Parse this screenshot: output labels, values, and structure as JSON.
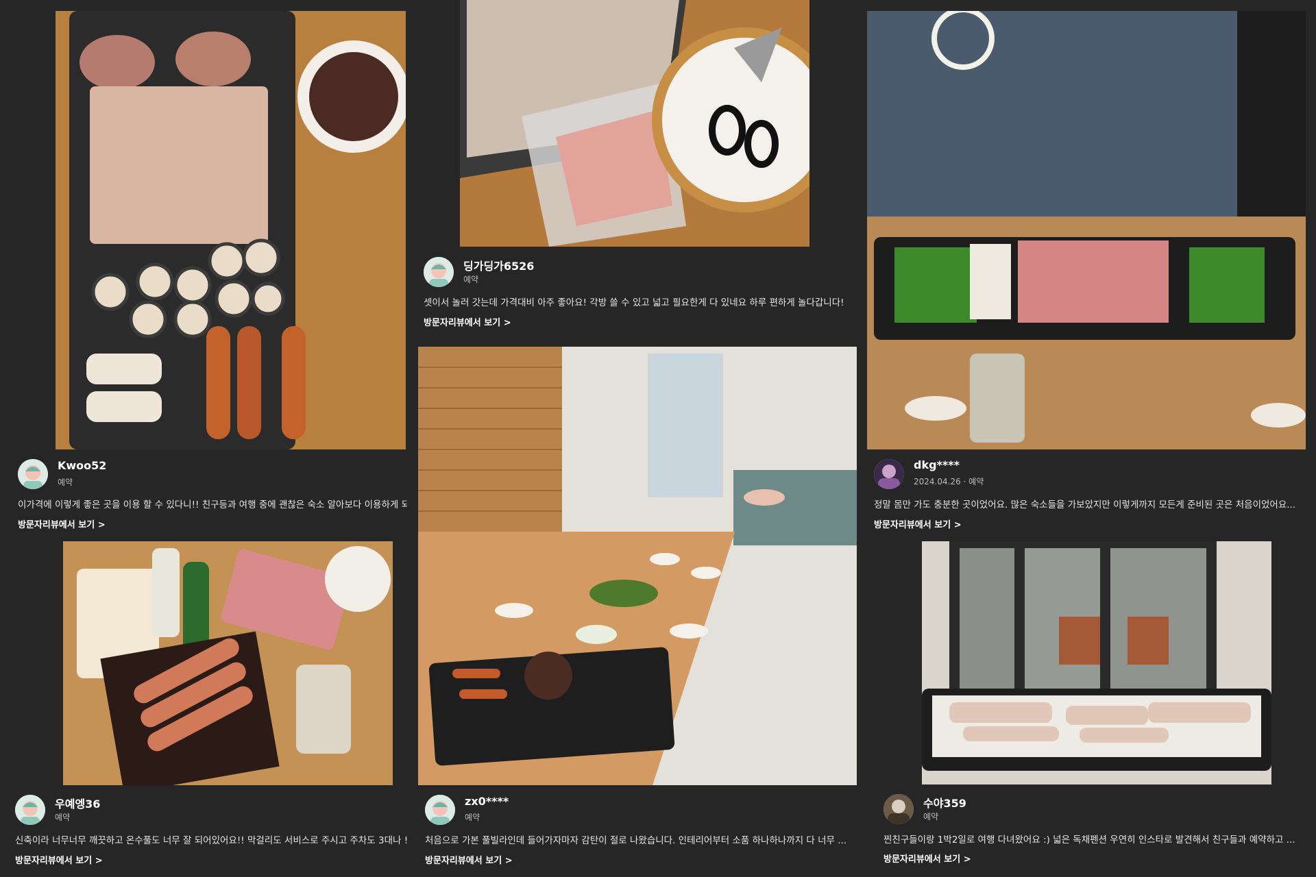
{
  "reviews": [
    {
      "user": "Kwoo52",
      "meta": "예약",
      "text": "이가격에 이렇게 좋은 곳을 이용 할 수 있다니!! 친구등과 여행 중에 괜찮은 숙소 알아보다 이용하게 되",
      "link": "방문자리뷰에서 보기 >"
    },
    {
      "user": "딩가딩가6526",
      "meta": "예약",
      "text": "셋이서 놀러 갓는데 가격대비 아주 좋아요! 각방 쓸 수 있고 넓고 필요한게 다 있네요 하루 편하게 놀다갑니다!",
      "link": "방문자리뷰에서 보기 >"
    },
    {
      "user": "dkg****",
      "meta": "2024.04.26 · 예약",
      "text": "정말 몸만 가도 충분한 곳이었어요. 많은 숙소들을 가보았지만 이렇게까지 모든게 준비된 곳은 처음이었어요...",
      "link": "방문자리뷰에서 보기 >"
    },
    {
      "user": "우예엥36",
      "meta": "예약",
      "text": "신축이라 너무너무 깨끗하고 온수풀도 너무 잘 되어있어요!! 막걸리도 서비스로 주시고 주차도 3대나 !",
      "link": "방문자리뷰에서 보기 >"
    },
    {
      "user": "zx0****",
      "meta": "예약",
      "text": "처음으로 가본 풀빌라인데 들어가자마자 감탄이 절로 나왔습니다. 인테리어부터 소품 하나하나까지 다 너무 ...",
      "link": "방문자리뷰에서 보기 >"
    },
    {
      "user": "수야359",
      "meta": "예약",
      "text": "찐친구들이랑 1박2일로 여행 다녀왔어요 :) 넓은 독채펜션 우연히 인스타로 발견해서 친구들과 예약하고 ...",
      "link": "방문자리뷰에서 보기 >"
    }
  ],
  "photos": [
    {
      "icon": "bbq-grill-photo"
    },
    {
      "icon": "raw-pork-tray-photo"
    },
    {
      "icon": "grill-table-window-photo"
    },
    {
      "icon": "grocery-table-photo"
    },
    {
      "icon": "dining-room-pool-photo"
    },
    {
      "icon": "grill-patio-photo"
    }
  ],
  "colors": {
    "background": "#1f1f20",
    "card": "#262627",
    "text": "#ffffff",
    "subtext": "#bdbdbd"
  }
}
